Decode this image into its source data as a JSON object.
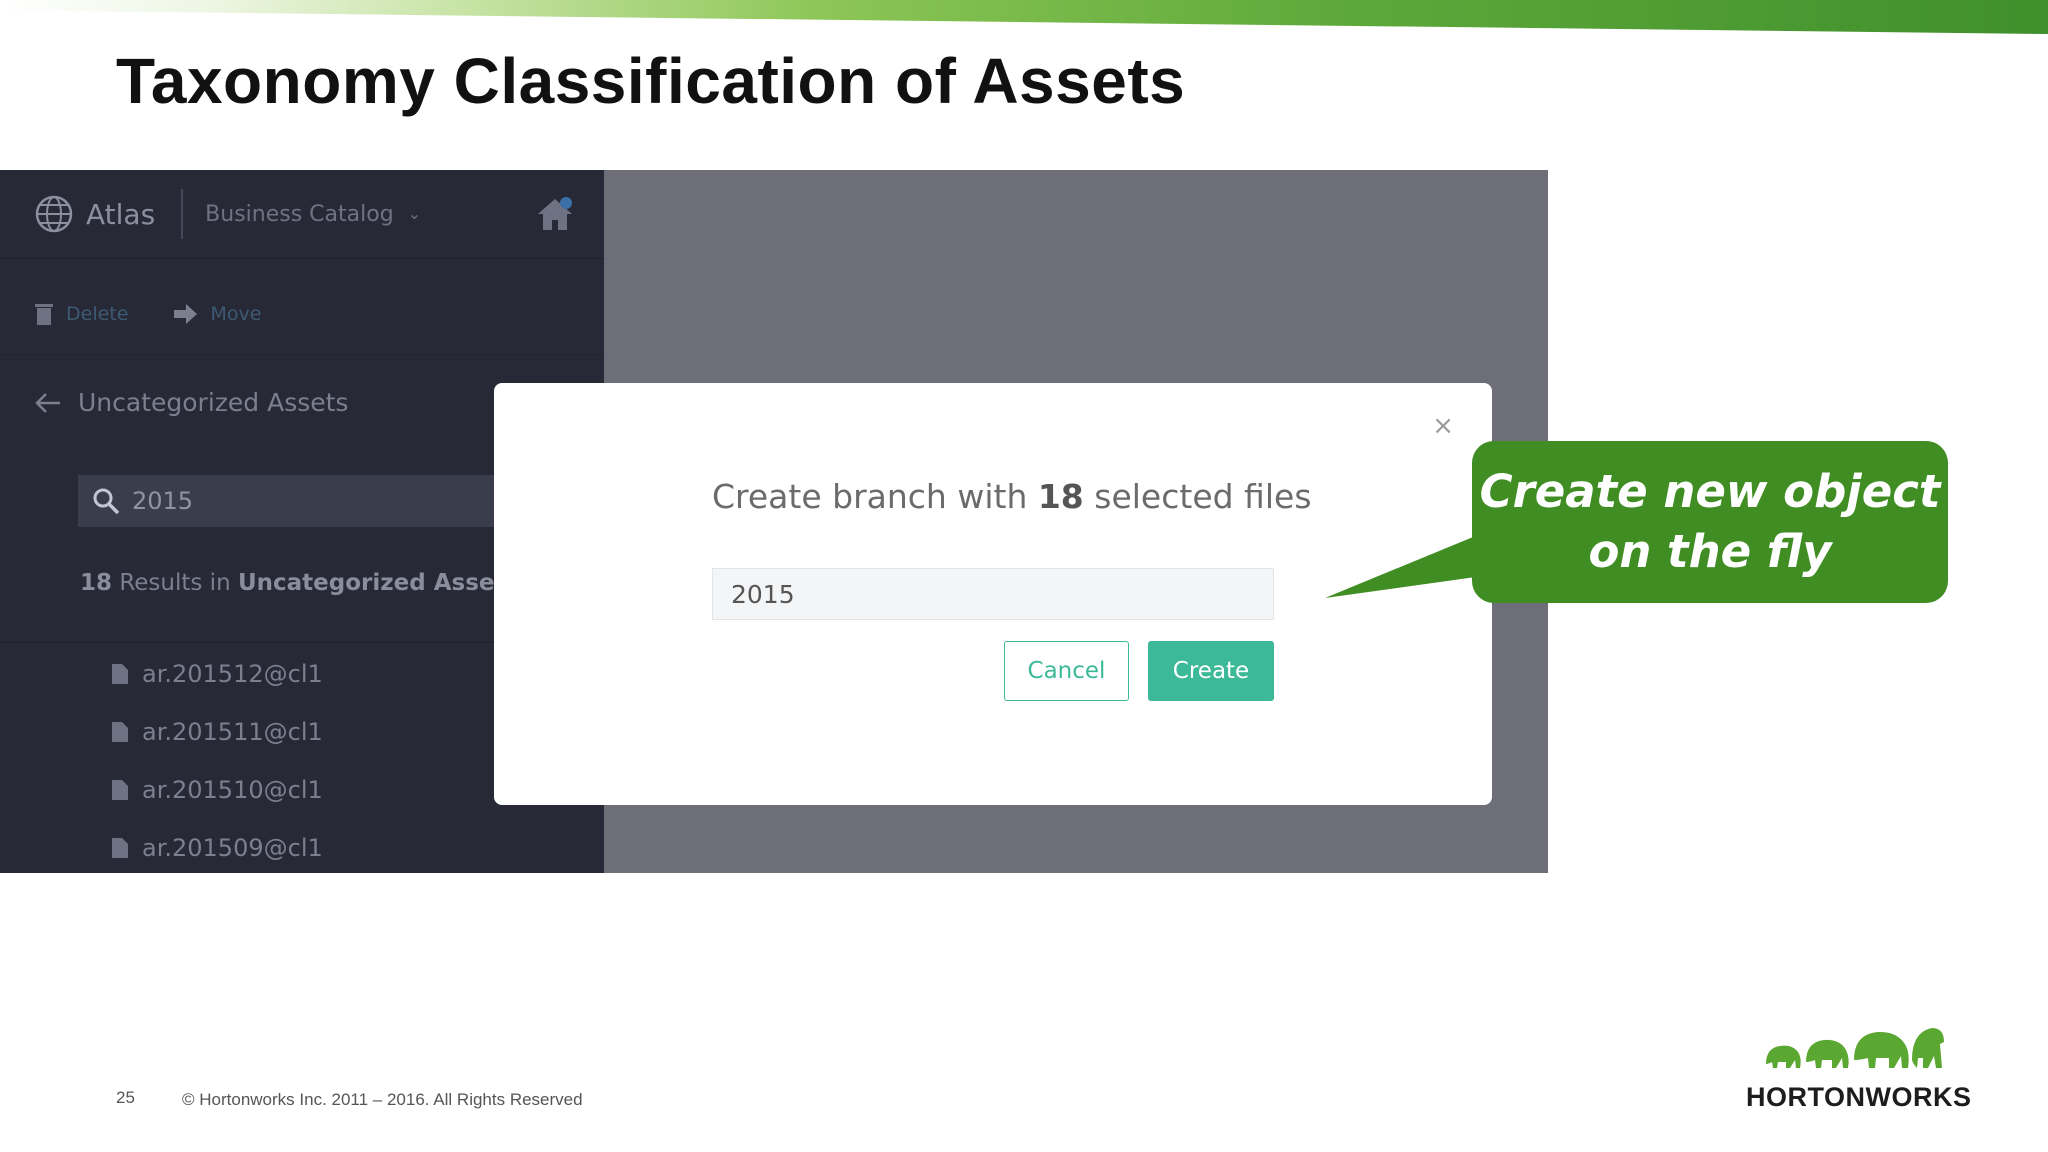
{
  "slide": {
    "title": "Taxonomy Classification of Assets",
    "page_number": "25",
    "copyright": "© Hortonworks Inc. 2011 – 2016. All Rights Reserved",
    "logo_text": "HORTONWORKS",
    "accent_color": "#3f8d23"
  },
  "app": {
    "name": "Atlas",
    "catalog": "Business Catalog",
    "toolbar": {
      "delete_label": "Delete",
      "move_label": "Move"
    },
    "back_label": "Uncategorized Assets",
    "search_value": "2015",
    "results": {
      "count": "18",
      "middle": " Results in ",
      "location": "Uncategorized Assets"
    },
    "files": [
      "ar.201512@cl1",
      "ar.201511@cl1",
      "ar.201510@cl1",
      "ar.201509@cl1"
    ]
  },
  "modal": {
    "heading_prefix": "Create branch with ",
    "heading_count": "18",
    "heading_suffix": " selected files",
    "input_value": "2015",
    "cancel_label": "Cancel",
    "create_label": "Create",
    "close_symbol": "×",
    "primary_color": "#3cb999"
  },
  "callout": {
    "line1": "Create new object",
    "line2": "on the fly"
  }
}
